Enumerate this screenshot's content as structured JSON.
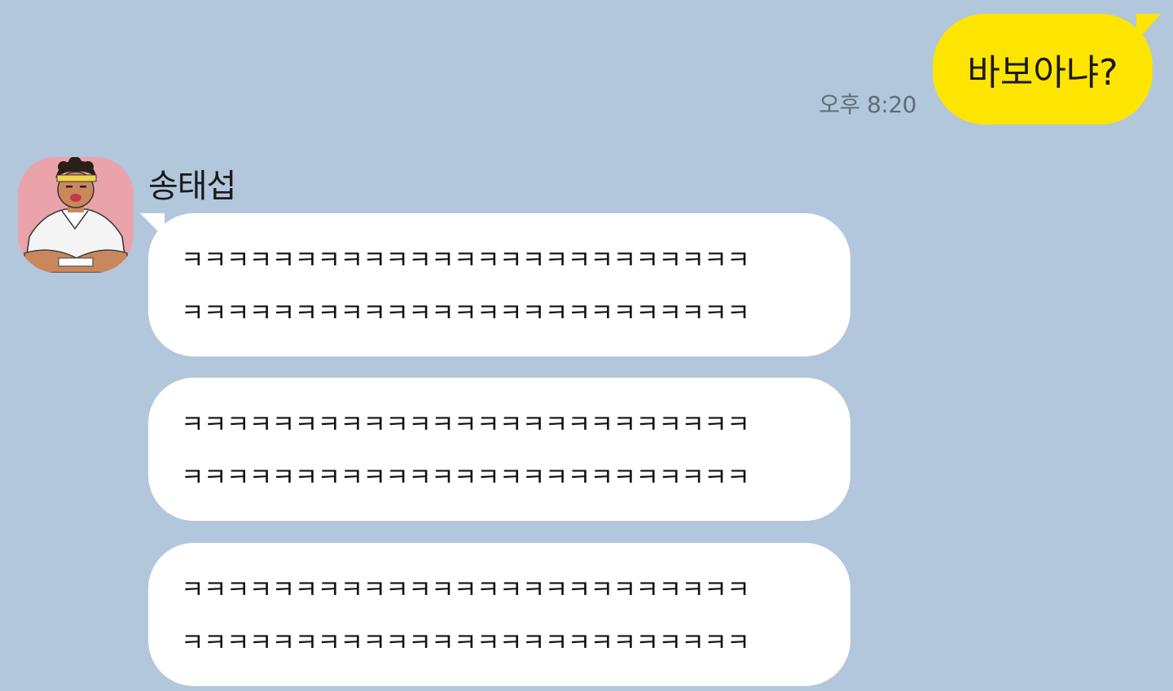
{
  "theme": {
    "background": "#b2c7db",
    "outgoing_bubble": "#fee500",
    "incoming_bubble": "#ffffff"
  },
  "outgoing": {
    "time": "오후 8:20",
    "text": "바보아냐?"
  },
  "incoming": {
    "sender": "송태섭",
    "avatar_icon": "cartoon-avatar",
    "messages": [
      {
        "lines": [
          "ㅋㅋㅋㅋㅋㅋㅋㅋㅋㅋㅋㅋㅋㅋㅋㅋㅋㅋㅋㅋㅋㅋㅋㅋㅋ",
          "ㅋㅋㅋㅋㅋㅋㅋㅋㅋㅋㅋㅋㅋㅋㅋㅋㅋㅋㅋㅋㅋㅋㅋㅋㅋ"
        ]
      },
      {
        "lines": [
          "ㅋㅋㅋㅋㅋㅋㅋㅋㅋㅋㅋㅋㅋㅋㅋㅋㅋㅋㅋㅋㅋㅋㅋㅋㅋ",
          "ㅋㅋㅋㅋㅋㅋㅋㅋㅋㅋㅋㅋㅋㅋㅋㅋㅋㅋㅋㅋㅋㅋㅋㅋㅋ"
        ]
      },
      {
        "lines": [
          "ㅋㅋㅋㅋㅋㅋㅋㅋㅋㅋㅋㅋㅋㅋㅋㅋㅋㅋㅋㅋㅋㅋㅋㅋㅋ",
          "ㅋㅋㅋㅋㅋㅋㅋㅋㅋㅋㅋㅋㅋㅋㅋㅋㅋㅋㅋㅋㅋㅋㅋㅋㅋ"
        ]
      }
    ]
  }
}
